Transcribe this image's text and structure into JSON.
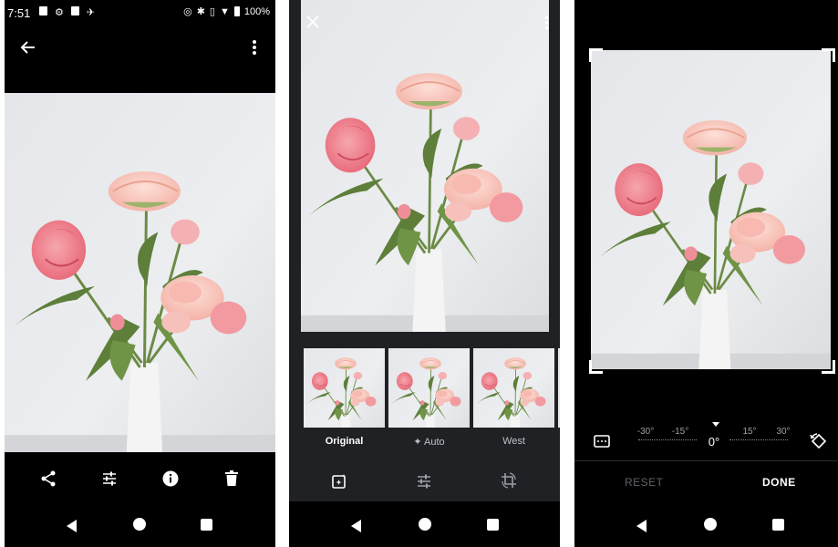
{
  "status_bar": {
    "time": "7:51",
    "battery": "100%"
  },
  "filters": {
    "thumbnails": [
      {
        "label": "Original",
        "selected": true
      },
      {
        "label": "Auto",
        "selected": false
      },
      {
        "label": "West",
        "selected": false
      }
    ]
  },
  "crop": {
    "dial": {
      "ticks": [
        "-30°",
        "-15°",
        "15°",
        "30°"
      ],
      "current": "0°"
    },
    "reset_label": "RESET",
    "done_label": "DONE"
  },
  "colors": {
    "accent": "#ffffff",
    "panel_bg": "#202124",
    "disabled": "#5f6368"
  },
  "icons": [
    "back-arrow-icon",
    "more-vert-icon",
    "share-icon",
    "tune-icon",
    "info-icon",
    "delete-icon",
    "close-icon",
    "auto-enhance-icon",
    "crop-rotate-icon",
    "aspect-ratio-icon",
    "rotate-icon"
  ]
}
